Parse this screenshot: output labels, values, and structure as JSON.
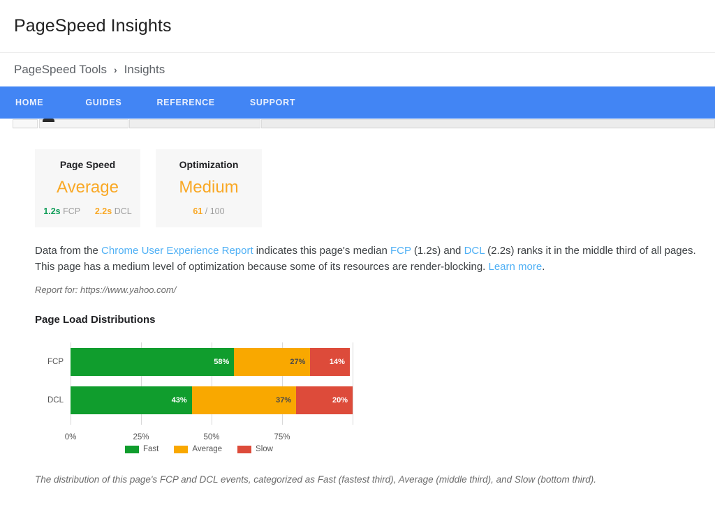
{
  "header": {
    "title": "PageSpeed Insights"
  },
  "breadcrumb": {
    "root": "PageSpeed Tools",
    "separator": "›",
    "current": "Insights"
  },
  "nav": {
    "items": [
      {
        "label": "HOME"
      },
      {
        "label": "GUIDES"
      },
      {
        "label": "REFERENCE"
      },
      {
        "label": "SUPPORT"
      }
    ],
    "background_color": "#4285f4"
  },
  "cards": [
    {
      "title": "Page Speed",
      "verdict": "Average",
      "verdict_color": "#f9a825",
      "metrics": [
        {
          "value": "1.2s",
          "label": "FCP",
          "color": "#0f9d58"
        },
        {
          "value": "2.2s",
          "label": "DCL",
          "color": "#f9a825"
        }
      ]
    },
    {
      "title": "Optimization",
      "verdict": "Medium",
      "verdict_color": "#f9a825",
      "score": "61",
      "score_suffix": "/ 100"
    }
  ],
  "summary": {
    "part1": "Data from the ",
    "link1": "Chrome User Experience Report",
    "part2": " indicates this page's median ",
    "link2": "FCP",
    "part3": " (1.2s) and ",
    "link3": "DCL",
    "part4": " (2.2s) ranks it in the middle third of all pages. This page has a medium level of optimization because some of its resources are render-blocking. ",
    "link4": "Learn more",
    "part5": "."
  },
  "report_for": "Report for: https://www.yahoo.com/",
  "section_title": "Page Load Distributions",
  "chart_caption": "The distribution of this page's FCP and DCL events, categorized as Fast (fastest third), Average (middle third), and Slow (bottom third).",
  "chart_data": {
    "type": "bar",
    "orientation": "horizontal",
    "stacked": true,
    "title": "Page Load Distributions",
    "xlabel": "",
    "ylabel": "",
    "categories": [
      "FCP",
      "DCL"
    ],
    "xticks": [
      "0%",
      "25%",
      "50%",
      "75%"
    ],
    "xtick_values": [
      0,
      25,
      50,
      75
    ],
    "xlim": [
      0,
      100
    ],
    "grid": true,
    "legend_position": "bottom",
    "series": [
      {
        "name": "Fast",
        "color": "#109d2d",
        "values": [
          58,
          43
        ],
        "labels": [
          "58%",
          "43%"
        ]
      },
      {
        "name": "Average",
        "color": "#f9a800",
        "values": [
          27,
          37
        ],
        "labels": [
          "27%",
          "37%"
        ]
      },
      {
        "name": "Slow",
        "color": "#dd4b3a",
        "values": [
          14,
          20
        ],
        "labels": [
          "14%",
          "20%"
        ]
      }
    ]
  }
}
